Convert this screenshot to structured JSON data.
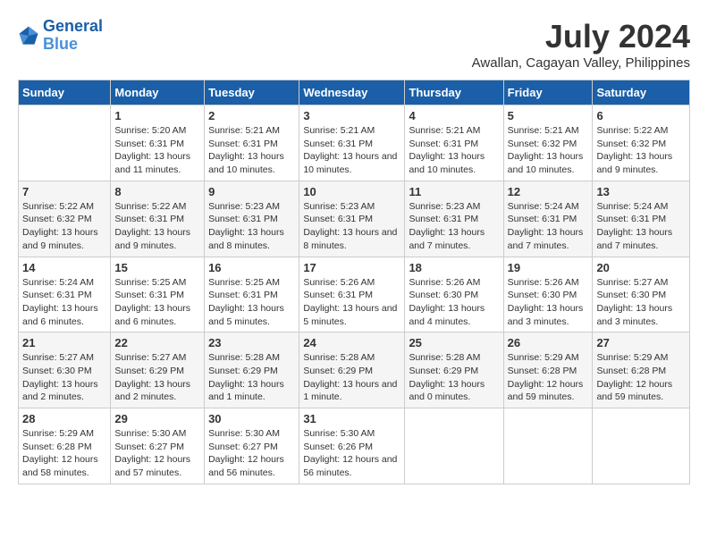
{
  "header": {
    "logo_line1": "General",
    "logo_line2": "Blue",
    "month_year": "July 2024",
    "location": "Awallan, Cagayan Valley, Philippines"
  },
  "weekdays": [
    "Sunday",
    "Monday",
    "Tuesday",
    "Wednesday",
    "Thursday",
    "Friday",
    "Saturday"
  ],
  "weeks": [
    [
      {
        "day": "",
        "sunrise": "",
        "sunset": "",
        "daylight": ""
      },
      {
        "day": "1",
        "sunrise": "Sunrise: 5:20 AM",
        "sunset": "Sunset: 6:31 PM",
        "daylight": "Daylight: 13 hours and 11 minutes."
      },
      {
        "day": "2",
        "sunrise": "Sunrise: 5:21 AM",
        "sunset": "Sunset: 6:31 PM",
        "daylight": "Daylight: 13 hours and 10 minutes."
      },
      {
        "day": "3",
        "sunrise": "Sunrise: 5:21 AM",
        "sunset": "Sunset: 6:31 PM",
        "daylight": "Daylight: 13 hours and 10 minutes."
      },
      {
        "day": "4",
        "sunrise": "Sunrise: 5:21 AM",
        "sunset": "Sunset: 6:31 PM",
        "daylight": "Daylight: 13 hours and 10 minutes."
      },
      {
        "day": "5",
        "sunrise": "Sunrise: 5:21 AM",
        "sunset": "Sunset: 6:32 PM",
        "daylight": "Daylight: 13 hours and 10 minutes."
      },
      {
        "day": "6",
        "sunrise": "Sunrise: 5:22 AM",
        "sunset": "Sunset: 6:32 PM",
        "daylight": "Daylight: 13 hours and 9 minutes."
      }
    ],
    [
      {
        "day": "7",
        "sunrise": "Sunrise: 5:22 AM",
        "sunset": "Sunset: 6:32 PM",
        "daylight": "Daylight: 13 hours and 9 minutes."
      },
      {
        "day": "8",
        "sunrise": "Sunrise: 5:22 AM",
        "sunset": "Sunset: 6:31 PM",
        "daylight": "Daylight: 13 hours and 9 minutes."
      },
      {
        "day": "9",
        "sunrise": "Sunrise: 5:23 AM",
        "sunset": "Sunset: 6:31 PM",
        "daylight": "Daylight: 13 hours and 8 minutes."
      },
      {
        "day": "10",
        "sunrise": "Sunrise: 5:23 AM",
        "sunset": "Sunset: 6:31 PM",
        "daylight": "Daylight: 13 hours and 8 minutes."
      },
      {
        "day": "11",
        "sunrise": "Sunrise: 5:23 AM",
        "sunset": "Sunset: 6:31 PM",
        "daylight": "Daylight: 13 hours and 7 minutes."
      },
      {
        "day": "12",
        "sunrise": "Sunrise: 5:24 AM",
        "sunset": "Sunset: 6:31 PM",
        "daylight": "Daylight: 13 hours and 7 minutes."
      },
      {
        "day": "13",
        "sunrise": "Sunrise: 5:24 AM",
        "sunset": "Sunset: 6:31 PM",
        "daylight": "Daylight: 13 hours and 7 minutes."
      }
    ],
    [
      {
        "day": "14",
        "sunrise": "Sunrise: 5:24 AM",
        "sunset": "Sunset: 6:31 PM",
        "daylight": "Daylight: 13 hours and 6 minutes."
      },
      {
        "day": "15",
        "sunrise": "Sunrise: 5:25 AM",
        "sunset": "Sunset: 6:31 PM",
        "daylight": "Daylight: 13 hours and 6 minutes."
      },
      {
        "day": "16",
        "sunrise": "Sunrise: 5:25 AM",
        "sunset": "Sunset: 6:31 PM",
        "daylight": "Daylight: 13 hours and 5 minutes."
      },
      {
        "day": "17",
        "sunrise": "Sunrise: 5:26 AM",
        "sunset": "Sunset: 6:31 PM",
        "daylight": "Daylight: 13 hours and 5 minutes."
      },
      {
        "day": "18",
        "sunrise": "Sunrise: 5:26 AM",
        "sunset": "Sunset: 6:30 PM",
        "daylight": "Daylight: 13 hours and 4 minutes."
      },
      {
        "day": "19",
        "sunrise": "Sunrise: 5:26 AM",
        "sunset": "Sunset: 6:30 PM",
        "daylight": "Daylight: 13 hours and 3 minutes."
      },
      {
        "day": "20",
        "sunrise": "Sunrise: 5:27 AM",
        "sunset": "Sunset: 6:30 PM",
        "daylight": "Daylight: 13 hours and 3 minutes."
      }
    ],
    [
      {
        "day": "21",
        "sunrise": "Sunrise: 5:27 AM",
        "sunset": "Sunset: 6:30 PM",
        "daylight": "Daylight: 13 hours and 2 minutes."
      },
      {
        "day": "22",
        "sunrise": "Sunrise: 5:27 AM",
        "sunset": "Sunset: 6:29 PM",
        "daylight": "Daylight: 13 hours and 2 minutes."
      },
      {
        "day": "23",
        "sunrise": "Sunrise: 5:28 AM",
        "sunset": "Sunset: 6:29 PM",
        "daylight": "Daylight: 13 hours and 1 minute."
      },
      {
        "day": "24",
        "sunrise": "Sunrise: 5:28 AM",
        "sunset": "Sunset: 6:29 PM",
        "daylight": "Daylight: 13 hours and 1 minute."
      },
      {
        "day": "25",
        "sunrise": "Sunrise: 5:28 AM",
        "sunset": "Sunset: 6:29 PM",
        "daylight": "Daylight: 13 hours and 0 minutes."
      },
      {
        "day": "26",
        "sunrise": "Sunrise: 5:29 AM",
        "sunset": "Sunset: 6:28 PM",
        "daylight": "Daylight: 12 hours and 59 minutes."
      },
      {
        "day": "27",
        "sunrise": "Sunrise: 5:29 AM",
        "sunset": "Sunset: 6:28 PM",
        "daylight": "Daylight: 12 hours and 59 minutes."
      }
    ],
    [
      {
        "day": "28",
        "sunrise": "Sunrise: 5:29 AM",
        "sunset": "Sunset: 6:28 PM",
        "daylight": "Daylight: 12 hours and 58 minutes."
      },
      {
        "day": "29",
        "sunrise": "Sunrise: 5:30 AM",
        "sunset": "Sunset: 6:27 PM",
        "daylight": "Daylight: 12 hours and 57 minutes."
      },
      {
        "day": "30",
        "sunrise": "Sunrise: 5:30 AM",
        "sunset": "Sunset: 6:27 PM",
        "daylight": "Daylight: 12 hours and 56 minutes."
      },
      {
        "day": "31",
        "sunrise": "Sunrise: 5:30 AM",
        "sunset": "Sunset: 6:26 PM",
        "daylight": "Daylight: 12 hours and 56 minutes."
      },
      {
        "day": "",
        "sunrise": "",
        "sunset": "",
        "daylight": ""
      },
      {
        "day": "",
        "sunrise": "",
        "sunset": "",
        "daylight": ""
      },
      {
        "day": "",
        "sunrise": "",
        "sunset": "",
        "daylight": ""
      }
    ]
  ]
}
